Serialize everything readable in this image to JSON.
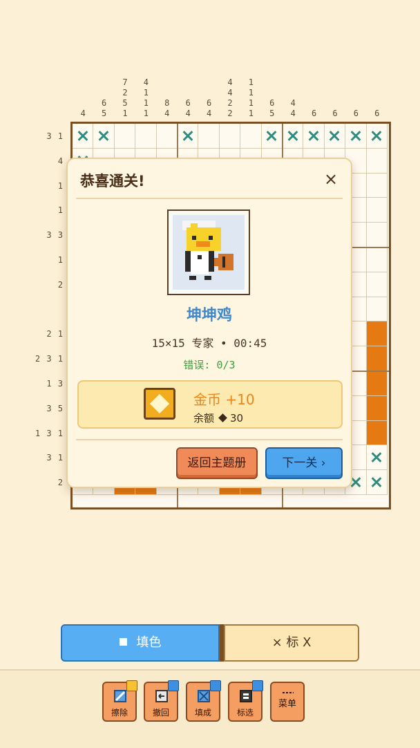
{
  "puzzle": {
    "size": 15,
    "column_clues": [
      [
        "4"
      ],
      [
        "6",
        "5"
      ],
      [
        "7",
        "2",
        "5",
        "1"
      ],
      [
        "4",
        "1",
        "1",
        "1"
      ],
      [
        "8",
        "4"
      ],
      [
        "6",
        "4"
      ],
      [
        "6",
        "4"
      ],
      [
        "4",
        "4",
        "2",
        "2"
      ],
      [
        "1",
        "1",
        "1",
        "1"
      ],
      [
        "6",
        "5"
      ],
      [
        "4",
        "4"
      ],
      [
        "6"
      ],
      [
        "6"
      ],
      [
        "6"
      ],
      [
        "6"
      ]
    ],
    "row_clues": [
      "3 1",
      "4",
      "1",
      "1",
      "3 3",
      "1",
      "2",
      "",
      "2 1",
      "2 3 1",
      "1 3",
      "3 5",
      "1 3 1",
      "3 1",
      "2"
    ],
    "cell_states": [
      "XX...X...XXXXXX",
      "X..............",
      "...............",
      "...............",
      "...............",
      "...............",
      "...............",
      "...............",
      "..............F",
      "..............F",
      "..............F",
      "..............F",
      "..............F",
      "..............X",
      "XXFFXXXFFXXXXXX"
    ]
  },
  "dialog": {
    "title": "恭喜通关!",
    "close_symbol": "×",
    "puzzle_name": "坤坤鸡",
    "info": "15×15 专家  •  00:45",
    "errors": "错误: 0/3",
    "reward": {
      "title": "金币 +10",
      "balance_label": "余额",
      "balance_value": "30"
    },
    "back_button": "返回主题册",
    "next_button": "下一关 ›"
  },
  "mode": {
    "fill_label": "填色",
    "mark_label": "× 标 X",
    "active": "fill"
  },
  "toolbar": {
    "erase": "擦除",
    "undo": "撤回",
    "auto_fill": "填成",
    "mark_select": "标选",
    "menu": "菜单"
  },
  "colors": {
    "fill": "#e67a12",
    "mark": "#2e8c80",
    "accent_blue": "#4ea6ee",
    "accent_orange": "#f08a58"
  }
}
